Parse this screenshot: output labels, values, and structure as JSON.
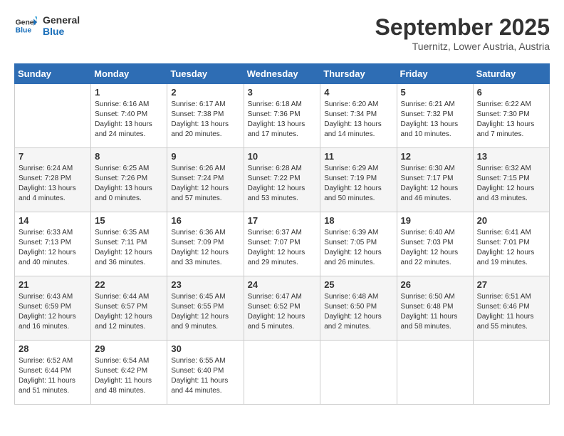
{
  "header": {
    "logo_line1": "General",
    "logo_line2": "Blue",
    "month": "September 2025",
    "location": "Tuernitz, Lower Austria, Austria"
  },
  "weekdays": [
    "Sunday",
    "Monday",
    "Tuesday",
    "Wednesday",
    "Thursday",
    "Friday",
    "Saturday"
  ],
  "weeks": [
    [
      {
        "day": "",
        "info": ""
      },
      {
        "day": "1",
        "info": "Sunrise: 6:16 AM\nSunset: 7:40 PM\nDaylight: 13 hours\nand 24 minutes."
      },
      {
        "day": "2",
        "info": "Sunrise: 6:17 AM\nSunset: 7:38 PM\nDaylight: 13 hours\nand 20 minutes."
      },
      {
        "day": "3",
        "info": "Sunrise: 6:18 AM\nSunset: 7:36 PM\nDaylight: 13 hours\nand 17 minutes."
      },
      {
        "day": "4",
        "info": "Sunrise: 6:20 AM\nSunset: 7:34 PM\nDaylight: 13 hours\nand 14 minutes."
      },
      {
        "day": "5",
        "info": "Sunrise: 6:21 AM\nSunset: 7:32 PM\nDaylight: 13 hours\nand 10 minutes."
      },
      {
        "day": "6",
        "info": "Sunrise: 6:22 AM\nSunset: 7:30 PM\nDaylight: 13 hours\nand 7 minutes."
      }
    ],
    [
      {
        "day": "7",
        "info": "Sunrise: 6:24 AM\nSunset: 7:28 PM\nDaylight: 13 hours\nand 4 minutes."
      },
      {
        "day": "8",
        "info": "Sunrise: 6:25 AM\nSunset: 7:26 PM\nDaylight: 13 hours\nand 0 minutes."
      },
      {
        "day": "9",
        "info": "Sunrise: 6:26 AM\nSunset: 7:24 PM\nDaylight: 12 hours\nand 57 minutes."
      },
      {
        "day": "10",
        "info": "Sunrise: 6:28 AM\nSunset: 7:22 PM\nDaylight: 12 hours\nand 53 minutes."
      },
      {
        "day": "11",
        "info": "Sunrise: 6:29 AM\nSunset: 7:19 PM\nDaylight: 12 hours\nand 50 minutes."
      },
      {
        "day": "12",
        "info": "Sunrise: 6:30 AM\nSunset: 7:17 PM\nDaylight: 12 hours\nand 46 minutes."
      },
      {
        "day": "13",
        "info": "Sunrise: 6:32 AM\nSunset: 7:15 PM\nDaylight: 12 hours\nand 43 minutes."
      }
    ],
    [
      {
        "day": "14",
        "info": "Sunrise: 6:33 AM\nSunset: 7:13 PM\nDaylight: 12 hours\nand 40 minutes."
      },
      {
        "day": "15",
        "info": "Sunrise: 6:35 AM\nSunset: 7:11 PM\nDaylight: 12 hours\nand 36 minutes."
      },
      {
        "day": "16",
        "info": "Sunrise: 6:36 AM\nSunset: 7:09 PM\nDaylight: 12 hours\nand 33 minutes."
      },
      {
        "day": "17",
        "info": "Sunrise: 6:37 AM\nSunset: 7:07 PM\nDaylight: 12 hours\nand 29 minutes."
      },
      {
        "day": "18",
        "info": "Sunrise: 6:39 AM\nSunset: 7:05 PM\nDaylight: 12 hours\nand 26 minutes."
      },
      {
        "day": "19",
        "info": "Sunrise: 6:40 AM\nSunset: 7:03 PM\nDaylight: 12 hours\nand 22 minutes."
      },
      {
        "day": "20",
        "info": "Sunrise: 6:41 AM\nSunset: 7:01 PM\nDaylight: 12 hours\nand 19 minutes."
      }
    ],
    [
      {
        "day": "21",
        "info": "Sunrise: 6:43 AM\nSunset: 6:59 PM\nDaylight: 12 hours\nand 16 minutes."
      },
      {
        "day": "22",
        "info": "Sunrise: 6:44 AM\nSunset: 6:57 PM\nDaylight: 12 hours\nand 12 minutes."
      },
      {
        "day": "23",
        "info": "Sunrise: 6:45 AM\nSunset: 6:55 PM\nDaylight: 12 hours\nand 9 minutes."
      },
      {
        "day": "24",
        "info": "Sunrise: 6:47 AM\nSunset: 6:52 PM\nDaylight: 12 hours\nand 5 minutes."
      },
      {
        "day": "25",
        "info": "Sunrise: 6:48 AM\nSunset: 6:50 PM\nDaylight: 12 hours\nand 2 minutes."
      },
      {
        "day": "26",
        "info": "Sunrise: 6:50 AM\nSunset: 6:48 PM\nDaylight: 11 hours\nand 58 minutes."
      },
      {
        "day": "27",
        "info": "Sunrise: 6:51 AM\nSunset: 6:46 PM\nDaylight: 11 hours\nand 55 minutes."
      }
    ],
    [
      {
        "day": "28",
        "info": "Sunrise: 6:52 AM\nSunset: 6:44 PM\nDaylight: 11 hours\nand 51 minutes."
      },
      {
        "day": "29",
        "info": "Sunrise: 6:54 AM\nSunset: 6:42 PM\nDaylight: 11 hours\nand 48 minutes."
      },
      {
        "day": "30",
        "info": "Sunrise: 6:55 AM\nSunset: 6:40 PM\nDaylight: 11 hours\nand 44 minutes."
      },
      {
        "day": "",
        "info": ""
      },
      {
        "day": "",
        "info": ""
      },
      {
        "day": "",
        "info": ""
      },
      {
        "day": "",
        "info": ""
      }
    ]
  ]
}
